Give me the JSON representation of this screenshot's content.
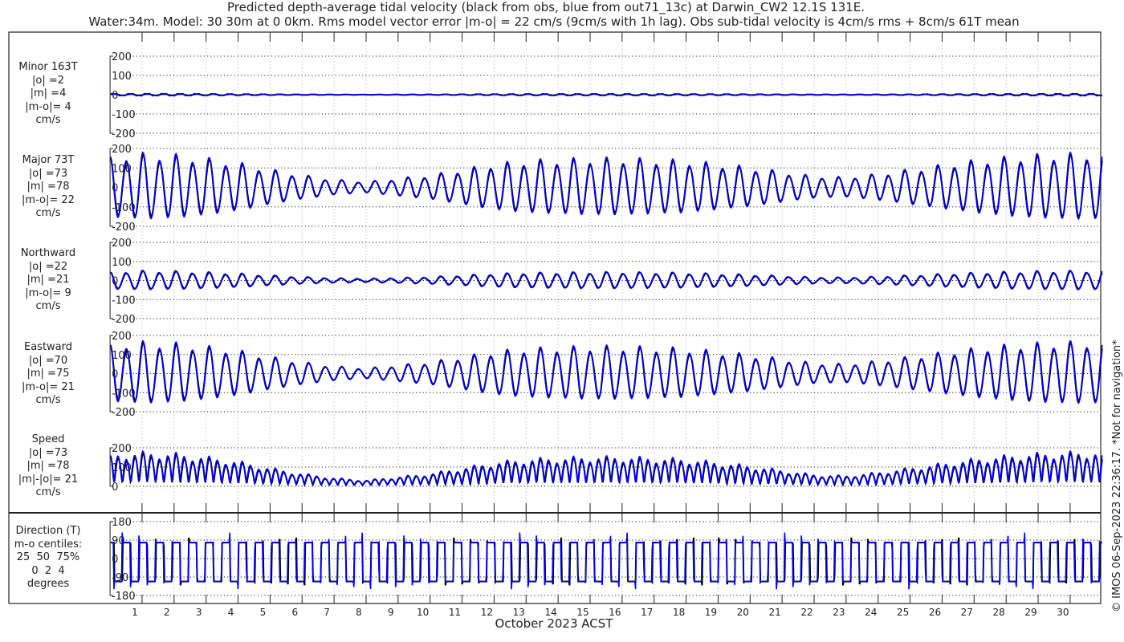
{
  "chart_data": {
    "type": "line",
    "title": "Predicted depth-average tidal velocity (black from obs, blue from out71_13c) at Darwin_CW2 12.1S 131E.",
    "subtitle": "Water:34m. Model: 30 30m at 0 0km. Rms model vector error |m-o| = 22 cm/s (9cm/s with 1h lag). Obs sub-tidal velocity is 4cm/s rms + 8cm/s 61T mean",
    "xlabel": "October 2023 ACST",
    "x_tick_labels": [
      "1",
      "2",
      "3",
      "4",
      "5",
      "6",
      "7",
      "8",
      "9",
      "10",
      "11",
      "12",
      "13",
      "14",
      "15",
      "16",
      "17",
      "18",
      "19",
      "20",
      "21",
      "22",
      "23",
      "24",
      "25",
      "26",
      "27",
      "28",
      "29",
      "30"
    ],
    "xlim_days": [
      0,
      31
    ],
    "series_colors": {
      "obs": "#000000",
      "model": "#0000ff"
    },
    "tide_period_hours": 12.42,
    "major_axis_direction_deg": 73,
    "daily_major_amplitude_obs_cm_s": [
      140,
      150,
      145,
      130,
      110,
      80,
      55,
      35,
      25,
      40,
      55,
      80,
      105,
      120,
      125,
      130,
      130,
      125,
      120,
      105,
      90,
      70,
      50,
      45,
      60,
      80,
      100,
      120,
      135,
      145,
      150
    ],
    "model_amplitude_ratio": 1.07,
    "panels": [
      {
        "name": "minor",
        "label_lines": [
          "Minor 163T",
          "|o| =2",
          "|m| =4",
          "|m-o|= 4",
          "cm/s"
        ],
        "yticks": [
          "200",
          "100",
          "0",
          "-100",
          "-200"
        ],
        "ylim": [
          -200,
          200
        ],
        "component": "minor"
      },
      {
        "name": "major",
        "label_lines": [
          "Major 73T",
          "|o| =73",
          "|m| =78",
          "|m-o|= 22",
          "cm/s"
        ],
        "yticks": [
          "200",
          "100",
          "0",
          "-100",
          "-200"
        ],
        "ylim": [
          -200,
          200
        ],
        "component": "major"
      },
      {
        "name": "northward",
        "label_lines": [
          "Northward",
          "|o| =22",
          "|m| =21",
          "|m-o|= 9",
          "cm/s"
        ],
        "yticks": [
          "200",
          "100",
          "0",
          "-100",
          "-200"
        ],
        "ylim": [
          -200,
          200
        ],
        "component": "north"
      },
      {
        "name": "eastward",
        "label_lines": [
          "Eastward",
          "|o| =70",
          "|m| =75",
          "|m-o|= 21",
          "cm/s"
        ],
        "yticks": [
          "200",
          "100",
          "0",
          "-100",
          "-200"
        ],
        "ylim": [
          -200,
          200
        ],
        "component": "east"
      },
      {
        "name": "speed",
        "label_lines": [
          "Speed",
          "|o| =73",
          "|m| =78",
          "|m|-|o|= 21",
          "cm/s"
        ],
        "yticks": [
          "200",
          "100",
          "0"
        ],
        "ylim": [
          0,
          200
        ],
        "component": "speed"
      },
      {
        "name": "direction",
        "label_lines": [
          "Direction (T)",
          "m-o centiles:",
          "25  50  75%",
          "0  2  4",
          "degrees"
        ],
        "yticks": [
          "180",
          "90",
          "0",
          "-90",
          "-180"
        ],
        "ylim": [
          -180,
          180
        ],
        "component": "direction"
      }
    ]
  },
  "copyright": "© IMOS 06-Sep-2023 22:36:17. *Not for navigation*"
}
